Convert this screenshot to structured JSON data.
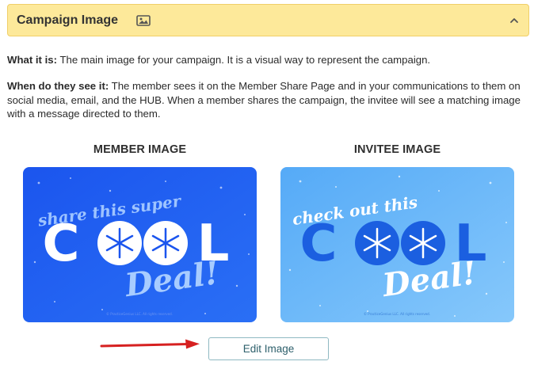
{
  "panel": {
    "title": "Campaign Image",
    "icon": "image-icon",
    "toggle_icon": "chevron-up-icon"
  },
  "description": {
    "what_label": "What it is:",
    "what_text": " The main image for your campaign. It is a visual way to represent the campaign.",
    "when_label": "When do they see it:",
    "when_text": " The member sees it on the Member Share Page and in your communications to them on social media, email, and the HUB. When a member shares the campaign, the invitee will see a matching image with a message directed to them."
  },
  "member_image": {
    "heading": "MEMBER IMAGE",
    "line1": "share this super",
    "big_word_1": "C",
    "big_word_2": "L",
    "script_word": "Deal!",
    "copyright": "© PracticeGenius LLC. All rights reserved.",
    "background": "#1f5cf0"
  },
  "invitee_image": {
    "heading": "INVITEE IMAGE",
    "line1": "check out this",
    "big_word_1": "C",
    "big_word_2": "L",
    "script_word": "Deal!",
    "copyright": "© PracticeGenius LLC. All rights reserved.",
    "background": "#5fb2f7"
  },
  "actions": {
    "edit_label": "Edit Image"
  },
  "colors": {
    "header_bg": "#fde99a",
    "arrow": "#d62020",
    "button_text": "#2d5f6b"
  }
}
